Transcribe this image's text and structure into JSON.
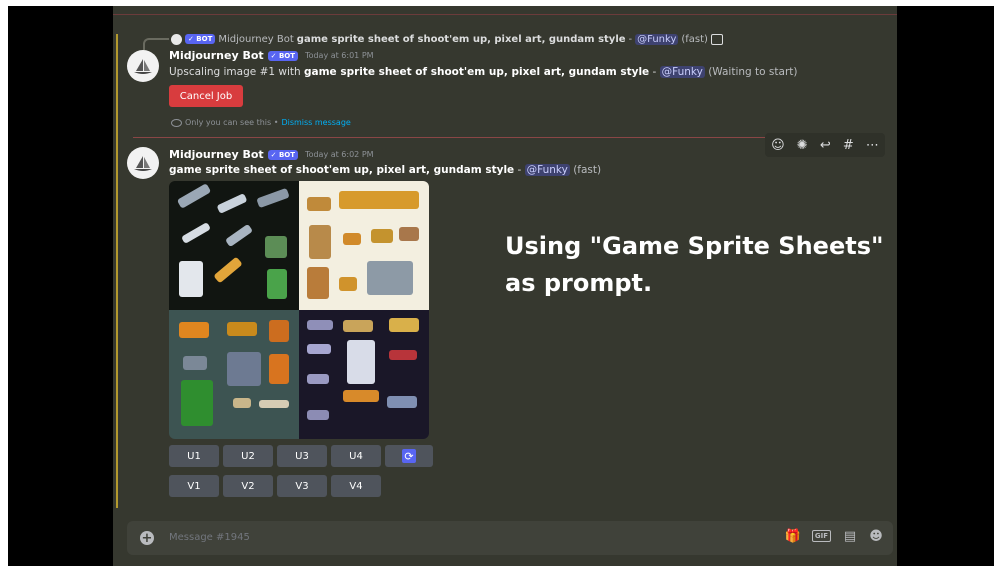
{
  "reply": {
    "author": "Midjourney Bot",
    "bot_tag": "✓ BOT",
    "prompt": "game sprite sheet of shoot'em up, pixel art, gundam style",
    "separator": " - ",
    "mention": "@Funky",
    "speed": "(fast)"
  },
  "message1": {
    "author": "Midjourney Bot",
    "bot_tag": "✓ BOT",
    "timestamp": "Today at 6:01 PM",
    "prefix": "Upscaling image #1 with ",
    "prompt": "game sprite sheet of shoot'em up, pixel art, gundam style",
    "separator": " - ",
    "mention": "@Funky",
    "status": "(Waiting to start)",
    "cancel_label": "Cancel Job",
    "ephemeral_note": "Only you can see this • ",
    "dismiss_label": "Dismiss message"
  },
  "message2": {
    "author": "Midjourney Bot",
    "bot_tag": "✓ BOT",
    "timestamp": "Today at 6:02 PM",
    "prompt": "game sprite sheet of shoot'em up, pixel art, gundam style",
    "separator": " - ",
    "mention": "@Funky",
    "speed": "(fast)",
    "upscale_buttons": [
      "U1",
      "U2",
      "U3",
      "U4"
    ],
    "reroll_icon": "⟳",
    "variation_buttons": [
      "V1",
      "V2",
      "V3",
      "V4"
    ]
  },
  "overlay": {
    "line1": "Using \"Game Sprite Sheets\"",
    "line2": "as prompt."
  },
  "composer": {
    "placeholder": "Message #1945"
  },
  "colors": {
    "background": "#36382f",
    "accent": "#5865f2",
    "danger": "#d83c3e",
    "mention_bg": "#3e4270"
  }
}
